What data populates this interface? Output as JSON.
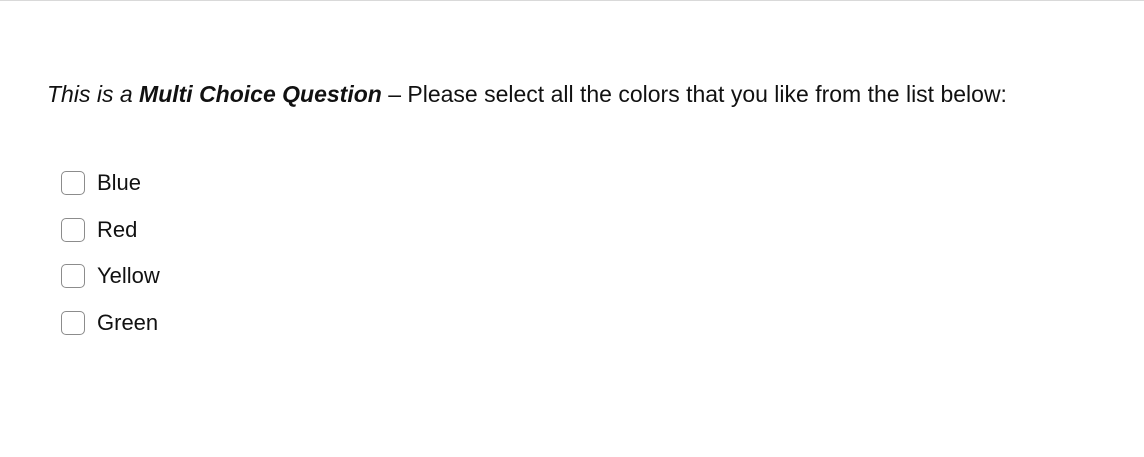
{
  "question": {
    "prefix": "This is a ",
    "emphasis": "Multi Choice Question",
    "suffix": " – Please select all the colors that you like from the list below:"
  },
  "options": [
    {
      "label": "Blue",
      "checked": false
    },
    {
      "label": "Red",
      "checked": false
    },
    {
      "label": "Yellow",
      "checked": false
    },
    {
      "label": "Green",
      "checked": false
    }
  ]
}
